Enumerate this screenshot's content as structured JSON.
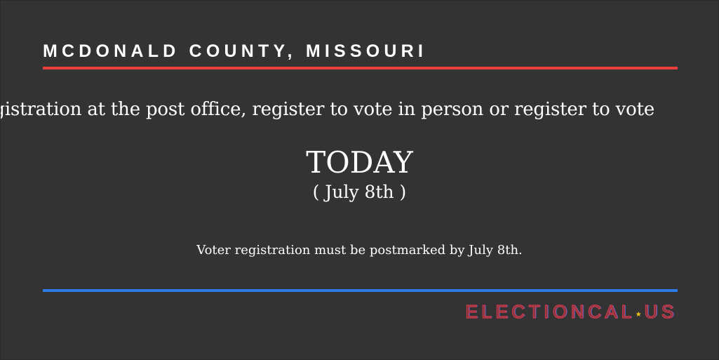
{
  "header": {
    "county": "MCDONALD COUNTY, MISSOURI"
  },
  "ticker": {
    "text": "registration at the post office, register to vote in person or register to vote"
  },
  "deadline": {
    "label": "TODAY",
    "date": "( July 8th )"
  },
  "note": "Voter registration must be postmarked by July 8th.",
  "logo": {
    "part1": "ELECTIONCAL",
    "star": "★",
    "part2": "US"
  },
  "colors": {
    "background": "#333333",
    "accent_red": "#e8403c",
    "accent_blue": "#2f7be8",
    "star_yellow": "#f5c518"
  }
}
